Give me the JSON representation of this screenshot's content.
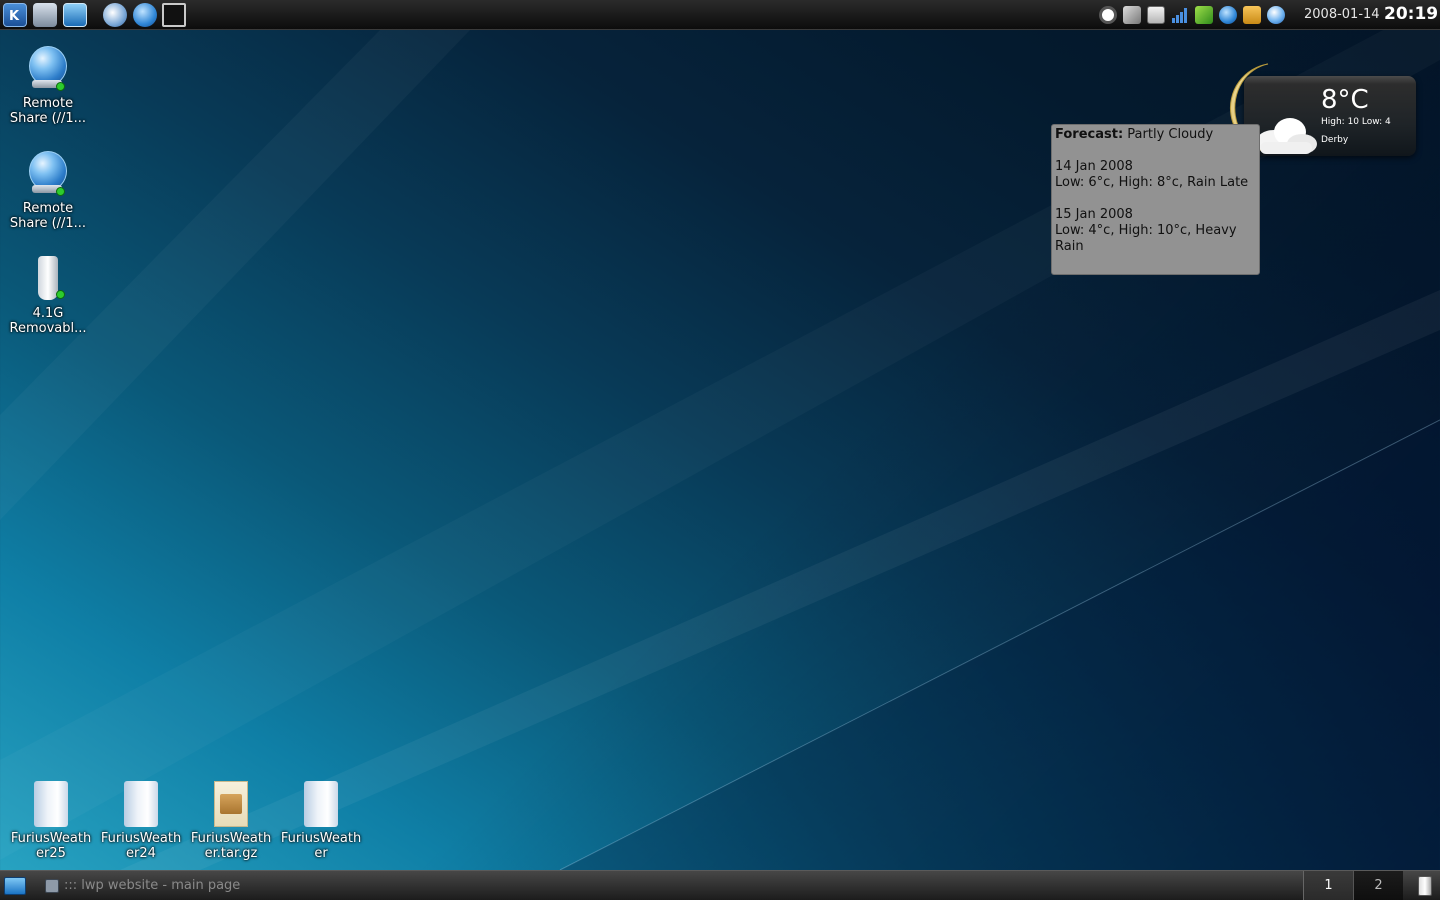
{
  "top_panel": {
    "launchers": [
      "kde-menu-icon",
      "system-settings-icon",
      "show-desktop-icon",
      "konqueror-icon",
      "browser-icon",
      "terminal-icon"
    ],
    "tray": [
      "network-icon",
      "sound-icon",
      "klipper-icon",
      "wifi-signal-icon",
      "battery-icon",
      "browser-tray-icon",
      "package-updater-icon",
      "globe-tray-icon"
    ],
    "date": "2008-01-14",
    "time": "20:19"
  },
  "desktop_icons": [
    {
      "label": "Remote Share (//1...",
      "icon": "remote-share-icon"
    },
    {
      "label": "Remote Share (//1...",
      "icon": "remote-share-icon"
    },
    {
      "label": "4.1G Removabl...",
      "icon": "usb-drive-icon"
    },
    {
      "label": "FuriusWeather25",
      "icon": "folder-icon"
    },
    {
      "label": "FuriusWeather24",
      "icon": "folder-icon"
    },
    {
      "label": "FuriusWeather.tar.gz",
      "icon": "package-icon"
    },
    {
      "label": "FuriusWeather",
      "icon": "folder-icon"
    }
  ],
  "weather": {
    "temperature": "8°C",
    "high_low": "High: 10 Low: 4",
    "city": "Derby",
    "tooltip": {
      "forecast_label": "Forecast:",
      "forecast_value": "Partly Cloudy",
      "day1_date": "14 Jan 2008",
      "day1_text": "Low: 6°c, High: 8°c, Rain Late",
      "day2_date": "15 Jan 2008",
      "day2_text": "Low: 4°c, High: 10°c, Heavy Rain"
    }
  },
  "taskbar": {
    "task_title": "::: lwp website - main page",
    "desktops": [
      "1",
      "2"
    ]
  }
}
